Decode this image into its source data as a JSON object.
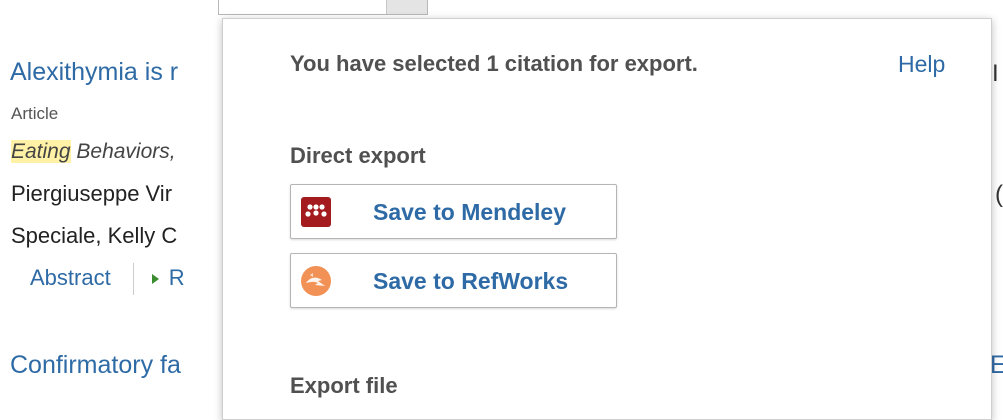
{
  "results": [
    {
      "title": "Alexithymia is r",
      "type": "Article",
      "source_highlight": "Eating",
      "source_rest": " Behaviors,",
      "authors_line1": "Piergiuseppe Vir",
      "authors_line2": "Speciale, Kelly C",
      "abstract_label": "Abstract",
      "related_label": "R"
    },
    {
      "title": "Confirmatory fa"
    }
  ],
  "edge_fragments": {
    "right_1": "I",
    "right_2": "(",
    "right_3": "E"
  },
  "export_popup": {
    "message": "You have selected 1 citation for export.",
    "help_label": "Help",
    "direct_export_heading": "Direct export",
    "buttons": [
      {
        "label": "Save to Mendeley",
        "icon": "mendeley-icon",
        "color": "#a31b1e"
      },
      {
        "label": "Save to RefWorks",
        "icon": "refworks-icon",
        "color": "#f29155"
      }
    ],
    "export_file_heading": "Export file"
  }
}
